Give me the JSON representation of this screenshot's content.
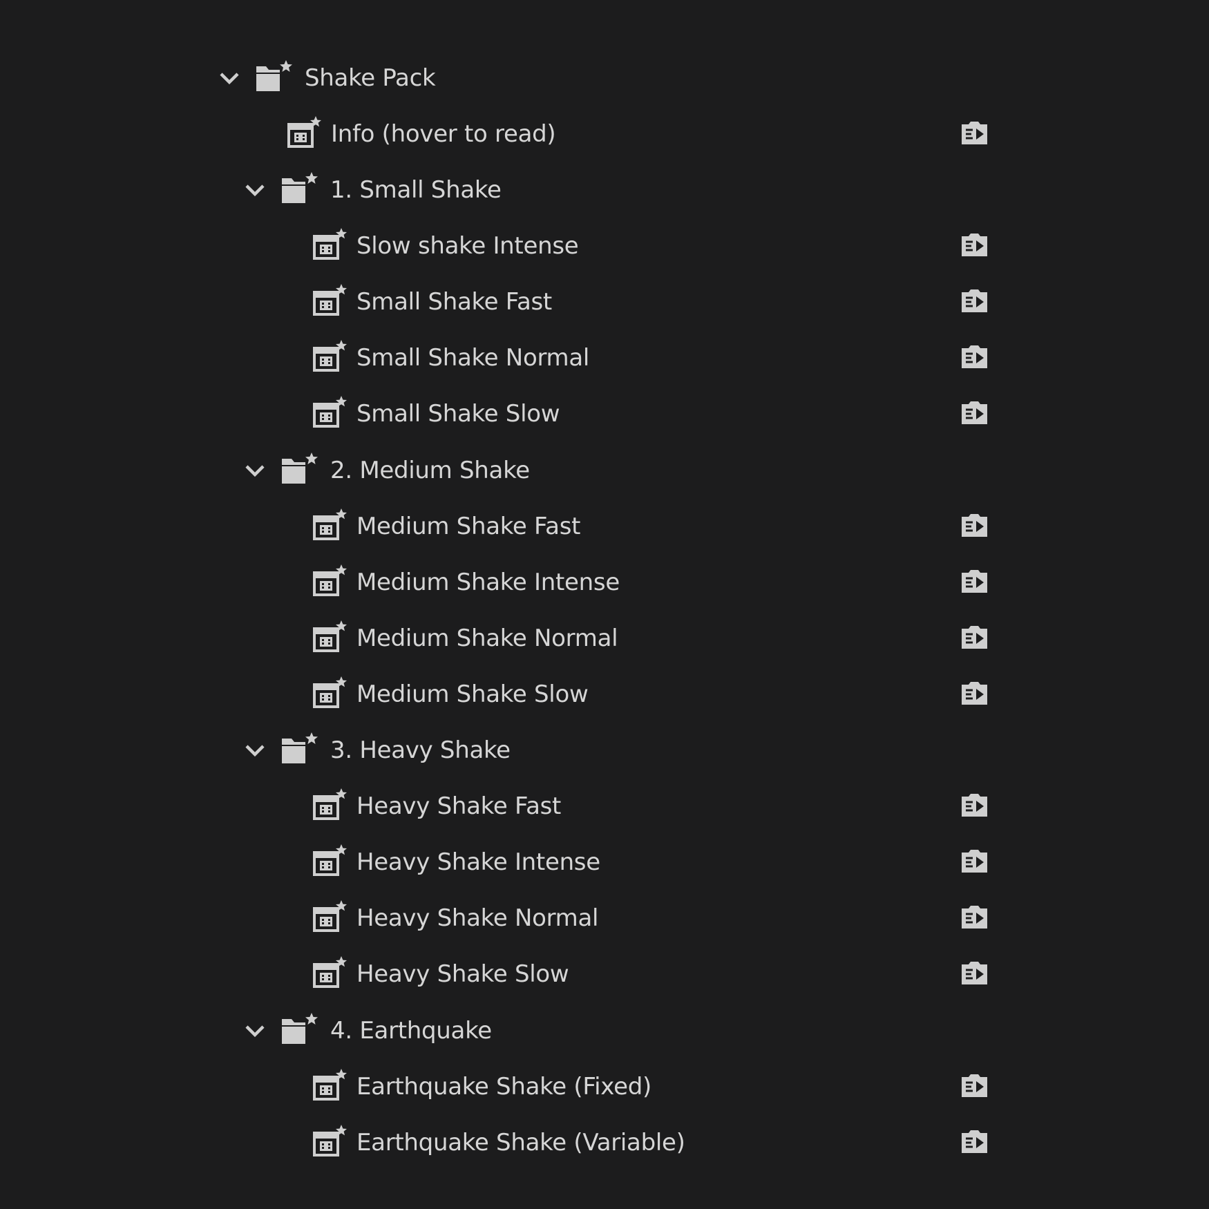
{
  "colors": {
    "background": "#1c1c1d",
    "text": "#d6d6d6",
    "icon": "#cfcfcf"
  },
  "root": {
    "label": "Shake Pack",
    "info_label": "Info (hover to read)"
  },
  "groups": [
    {
      "label": "1. Small Shake",
      "presets": [
        "Slow shake Intense",
        "Small Shake Fast",
        "Small Shake Normal",
        "Small Shake Slow"
      ]
    },
    {
      "label": "2. Medium Shake",
      "presets": [
        "Medium Shake Fast",
        "Medium Shake Intense",
        "Medium Shake Normal",
        "Medium Shake Slow"
      ]
    },
    {
      "label": "3. Heavy Shake",
      "presets": [
        "Heavy Shake Fast",
        "Heavy Shake Intense",
        "Heavy Shake Normal",
        "Heavy Shake Slow"
      ]
    },
    {
      "label": "4. Earthquake",
      "presets": [
        "Earthquake Shake (Fixed)",
        "Earthquake Shake (Variable)"
      ]
    }
  ]
}
